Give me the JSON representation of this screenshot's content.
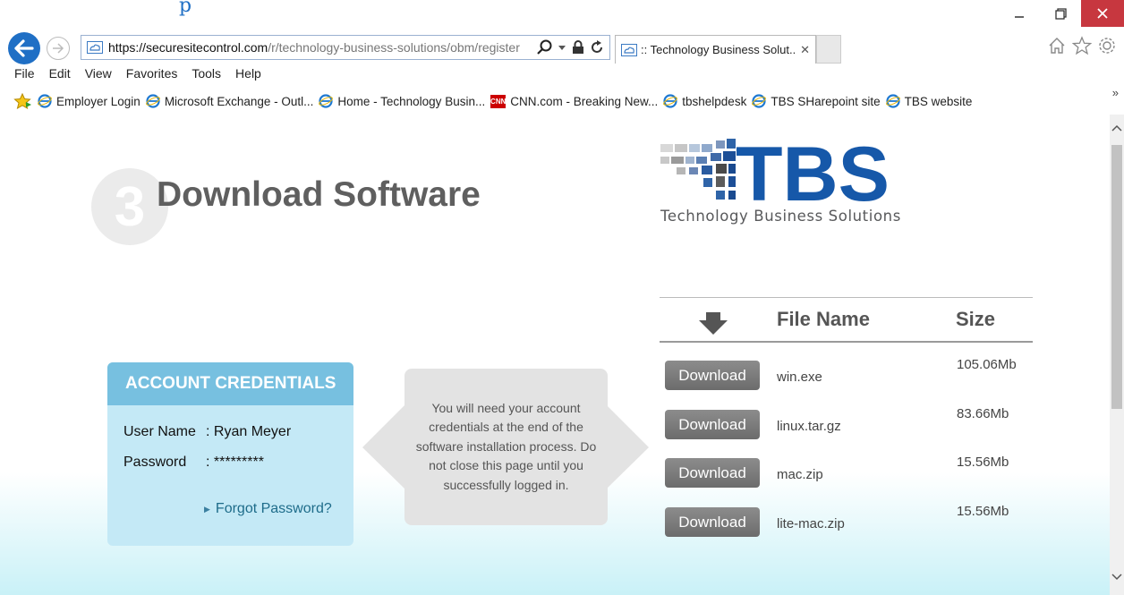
{
  "browser": {
    "address_host": "https://securesitecontrol.com",
    "address_path": "/r/technology-business-solutions/obm/register",
    "tab_title": ":: Technology Business Solut...",
    "menu": [
      "File",
      "Edit",
      "View",
      "Favorites",
      "Tools",
      "Help"
    ],
    "favorites": [
      {
        "label": "Employer Login",
        "icon": "ie-icon"
      },
      {
        "label": "Microsoft Exchange - Outl...",
        "icon": "ie-icon"
      },
      {
        "label": "Home - Technology Busin...",
        "icon": "ie-icon"
      },
      {
        "label": "CNN.com - Breaking New...",
        "icon": "cnn-icon"
      },
      {
        "label": "tbshelpdesk",
        "icon": "ie-icon"
      },
      {
        "label": "TBS SHarepoint site",
        "icon": "ie-icon"
      },
      {
        "label": "TBS website",
        "icon": "ie-icon"
      }
    ],
    "cnn_badge": "CNN",
    "top_stripe_char": "p",
    "overflow_chevron": "»"
  },
  "page": {
    "step_number": "3",
    "title": "Download Software",
    "logo_text": "TBS",
    "logo_subtitle": "Technology Business Solutions",
    "credentials": {
      "header": "ACCOUNT CREDENTIALS",
      "username_label": "User Name",
      "username_value": ": Ryan Meyer",
      "password_label": "Password",
      "password_value": ": *********",
      "forgot_link": "Forgot Password?"
    },
    "note": "You will need your account credentials at the end of the software installation process. Do not close this page until you successfully logged in.",
    "table": {
      "col_file": "File Name",
      "col_size": "Size",
      "rows": [
        {
          "button": "Download",
          "file": "win.exe",
          "size": "105.06Mb"
        },
        {
          "button": "Download",
          "file": "linux.tar.gz",
          "size": "83.66Mb"
        },
        {
          "button": "Download",
          "file": "mac.zip",
          "size": "15.56Mb"
        },
        {
          "button": "Download",
          "file": "lite-mac.zip",
          "size": "15.56Mb"
        }
      ]
    }
  },
  "colors": {
    "accent": "#1f6fc5",
    "logo_blue": "#1658a9",
    "creds_header": "#77c0e0",
    "creds_body": "#c4e9f6",
    "close_button": "#c7373f"
  }
}
